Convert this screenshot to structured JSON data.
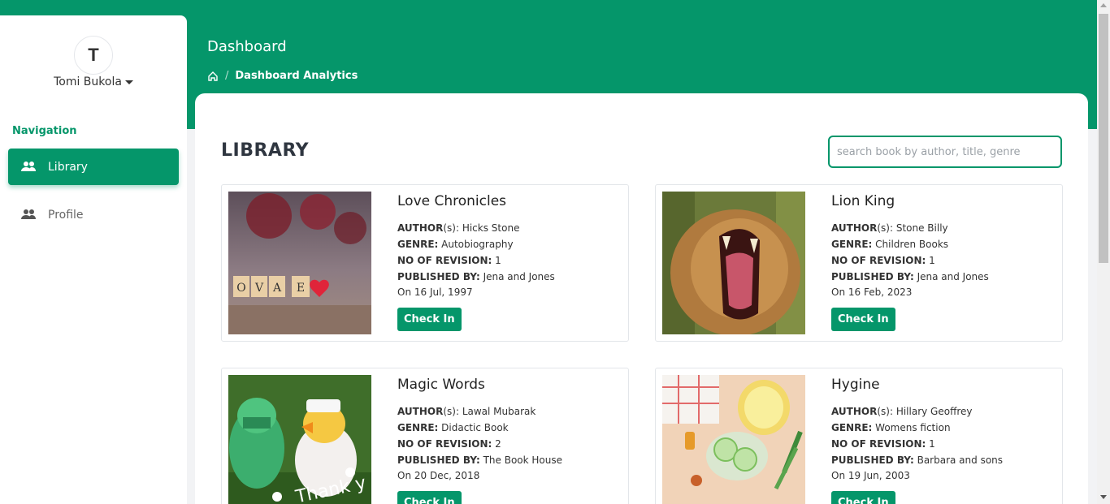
{
  "user": {
    "avatar_initial": "T",
    "name": "Tomi Bukola"
  },
  "sidebar": {
    "heading": "Navigation",
    "items": [
      {
        "label": "Library",
        "icon": "users-icon",
        "active": true
      },
      {
        "label": "Profile",
        "icon": "users-icon",
        "active": false
      }
    ]
  },
  "header": {
    "title": "Dashboard",
    "breadcrumb": {
      "home_icon": "home-icon",
      "current": "Dashboard Analytics"
    }
  },
  "library": {
    "title": "LIBRARY",
    "search_placeholder": "search book by author, title, genre",
    "labels": {
      "author": "AUTHOR",
      "author_suffix": "(s)",
      "genre": "GENRE:",
      "revision": "NO OF REVISION:",
      "published_by": "PUBLISHED BY:"
    },
    "checkin_label": "Check In",
    "books": [
      {
        "title": "Love Chronicles",
        "author": "Hicks Stone",
        "genre": "Autobiography",
        "revision": "1",
        "publisher": "Jena and Jones",
        "date": "On 16 Jul, 1997"
      },
      {
        "title": "Lion King",
        "author": "Stone Billy",
        "genre": "Children Books",
        "revision": "1",
        "publisher": "Jena and Jones",
        "date": "On 16 Feb, 2023"
      },
      {
        "title": "Magic Words",
        "author": "Lawal Mubarak",
        "genre": "Didactic Book",
        "revision": "2",
        "publisher": "The Book House",
        "date": "On 20 Dec, 2018"
      },
      {
        "title": "Hygine",
        "author": "Hillary Geoffrey",
        "genre": "Womens fiction",
        "revision": "1",
        "publisher": "Barbara and sons",
        "date": "On 19 Jun, 2003"
      }
    ]
  },
  "colors": {
    "brand": "#05966a",
    "background": "#f2f3f5",
    "card": "#ffffff"
  }
}
